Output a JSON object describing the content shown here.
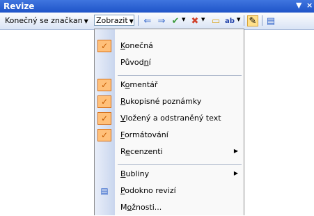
{
  "window": {
    "title": "Revize",
    "menu_glyph": "▼",
    "close_glyph": "×"
  },
  "toolbar": {
    "markup_combo": {
      "value": "Konečný se značkan",
      "arrow": "▼"
    },
    "show_button": {
      "label": "Zobrazit",
      "arrow": "▼"
    },
    "icons": [
      {
        "name": "previous-change-icon",
        "glyph": "⇐"
      },
      {
        "name": "next-change-icon",
        "glyph": "⇒"
      },
      {
        "name": "accept-change-icon",
        "glyph": "✔"
      },
      {
        "name": "reject-change-icon",
        "glyph": "✖"
      },
      {
        "name": "new-comment-icon",
        "glyph": "▭"
      },
      {
        "name": "highlight-icon",
        "glyph": "ab"
      },
      {
        "name": "track-changes-icon",
        "glyph": "✎"
      },
      {
        "name": "reviewing-pane-icon",
        "glyph": "▤"
      }
    ]
  },
  "menu": {
    "items": [
      {
        "id": "final",
        "label": "Konečná",
        "access_index": 0,
        "checked": true
      },
      {
        "id": "original",
        "label": "Původní",
        "access_index": 5,
        "checked": false
      },
      {
        "id": "comments",
        "label": "Komentář",
        "access_index": 1,
        "checked": true
      },
      {
        "id": "ink",
        "label": "Rukopisné poznámky",
        "access_index": 0,
        "checked": true
      },
      {
        "id": "insdel",
        "label": "Vložený a odstraněný text",
        "access_index": 0,
        "checked": true
      },
      {
        "id": "formatting",
        "label": "Formátování",
        "access_index": 0,
        "checked": true
      },
      {
        "id": "reviewers",
        "label": "Recenzenti",
        "access_index": 1,
        "checked": false,
        "submenu": true
      },
      {
        "id": "balloons",
        "label": "Bubliny",
        "access_index": 0,
        "checked": false,
        "submenu": true
      },
      {
        "id": "pane",
        "label": "Podokno revizí",
        "access_index": 0,
        "checked": false,
        "icon": "reviewing-pane-icon"
      },
      {
        "id": "options",
        "label": "Možnosti...",
        "access_index": 1,
        "checked": false
      }
    ]
  }
}
